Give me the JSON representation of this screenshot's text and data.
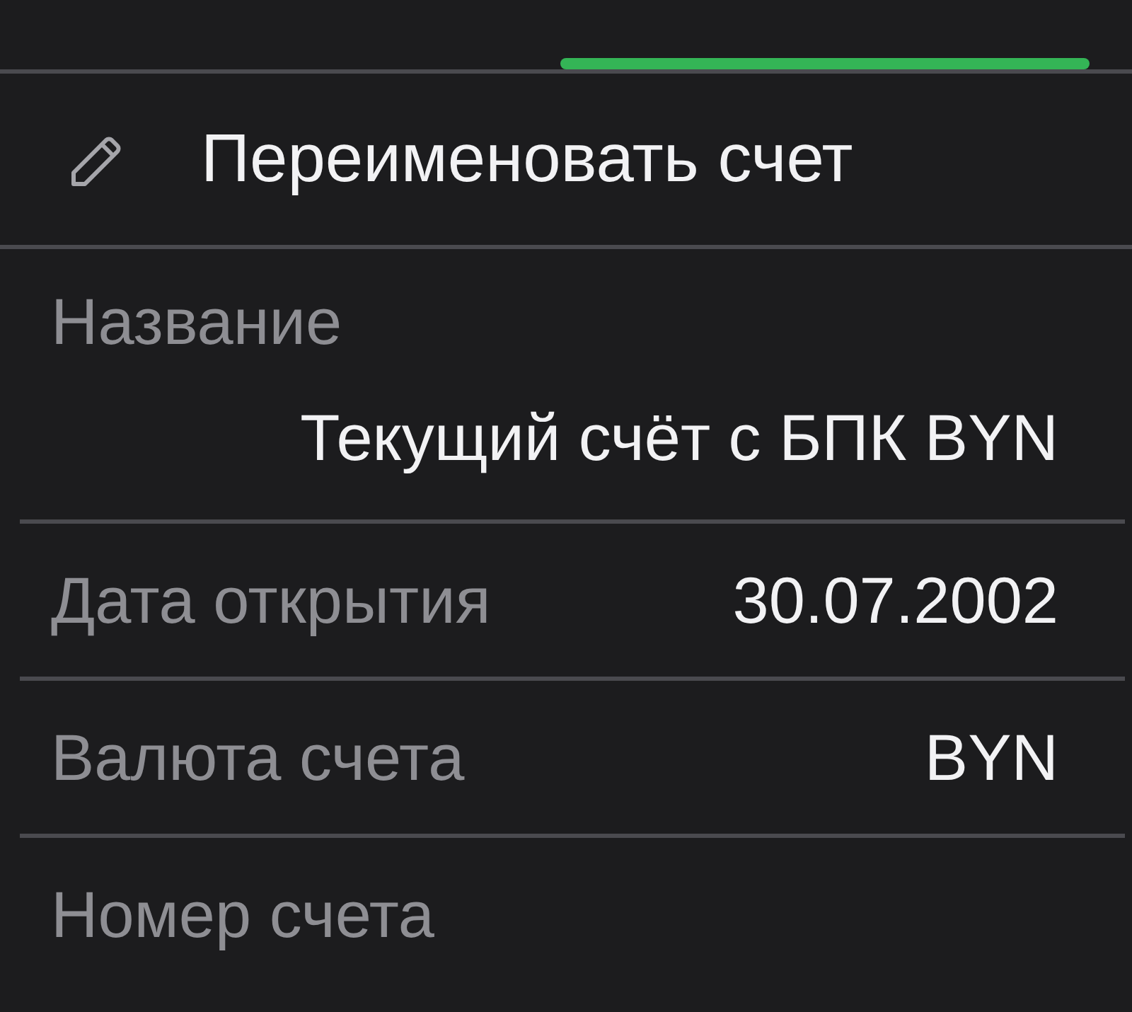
{
  "tabs": [
    {
      "selected": false
    },
    {
      "selected": true
    }
  ],
  "action": {
    "label": "Переименовать счет"
  },
  "fields": [
    {
      "label": "Название",
      "value": "Текущий счёт с БПК BYN",
      "kind": "stacked"
    },
    {
      "label": "Дата открытия",
      "value": "30.07.2002",
      "kind": "inline"
    },
    {
      "label": "Валюта счета",
      "value": "BYN",
      "kind": "inline"
    },
    {
      "label": "Номер счета",
      "kind": "inline"
    }
  ]
}
